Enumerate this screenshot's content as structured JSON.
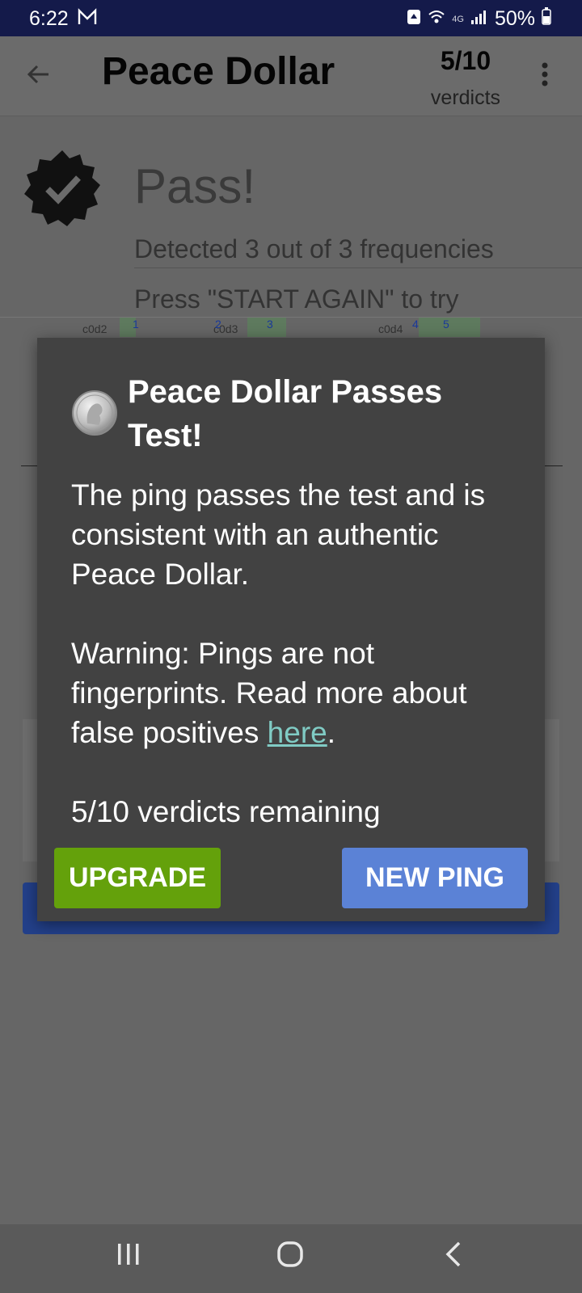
{
  "status": {
    "time": "6:22",
    "network": "4G",
    "battery": "50%"
  },
  "appbar": {
    "title": "Peace Dollar",
    "verdicts_count": "5/10",
    "verdicts_label": "verdicts"
  },
  "result": {
    "title": "Pass!",
    "detected": "Detected 3 out of 3 frequencies",
    "hint": "Press \"START AGAIN\" to try"
  },
  "freq_labels": [
    "c0d2",
    "c0d3",
    "c0d4"
  ],
  "freq_markers": [
    "1",
    "2",
    "3",
    "4",
    "5"
  ],
  "dialog": {
    "title": "Peace Dollar Passes Test!",
    "body1": "The ping passes the test and is consistent with an authentic Peace Dollar.",
    "body2_prefix": "Warning: Pings are not fingerprints. Read more about false positives ",
    "body2_link": "here",
    "body2_suffix": ".",
    "remaining": "5/10 verdicts remaining",
    "upgrade_label": "UPGRADE",
    "new_ping_label": "NEW PING"
  },
  "colors": {
    "upgrade": "#64a10b",
    "new_ping": "#5b82d6",
    "link": "#80cbc4",
    "dialog_bg": "#424242"
  },
  "icons": [
    "mail-icon",
    "wifi-icon",
    "signal-icon",
    "battery-icon",
    "back-arrow-icon",
    "more-vert-icon",
    "verified-badge-icon",
    "coin-icon",
    "recent-apps-icon",
    "home-icon",
    "back-icon"
  ]
}
